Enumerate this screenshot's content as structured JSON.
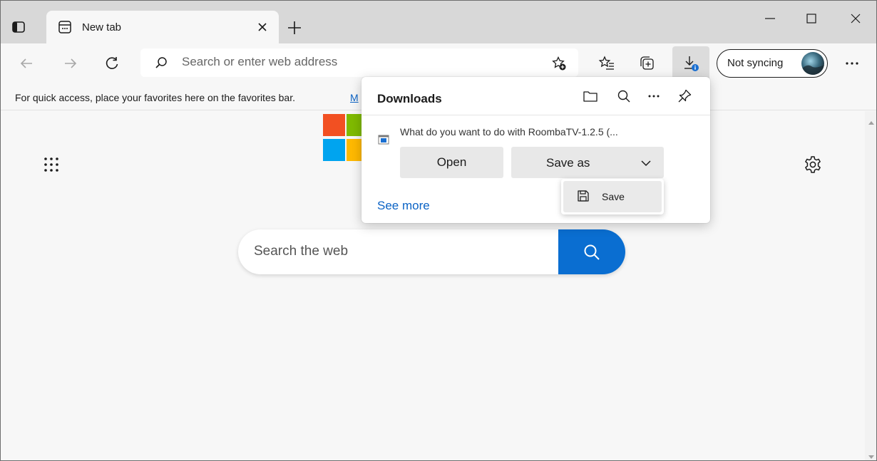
{
  "tab": {
    "title": "New tab"
  },
  "addressbar": {
    "placeholder": "Search or enter web address"
  },
  "profile": {
    "status": "Not syncing"
  },
  "favorites_bar": {
    "message": "For quick access, place your favorites here on the favorites bar.",
    "link": "M"
  },
  "new_tab_page": {
    "search_placeholder": "Search the web"
  },
  "downloads": {
    "title": "Downloads",
    "file_prompt": "What do you want to do with RoombaTV-1.2.5 (...",
    "open_label": "Open",
    "save_as_label": "Save as",
    "see_more": "See more"
  },
  "save_menu": {
    "items": [
      {
        "label": "Save"
      }
    ]
  },
  "icons": [
    "tab-actions-icon",
    "tab-favicon-icon",
    "close-icon",
    "plus-icon",
    "minimize-icon",
    "maximize-icon",
    "back-icon",
    "forward-icon",
    "refresh-icon",
    "search-icon",
    "add-favorite-icon",
    "favorites-icon",
    "collections-icon",
    "download-icon",
    "more-icon",
    "folder-icon",
    "pin-icon",
    "apps-grid-icon",
    "settings-gear-icon",
    "chevron-down-icon",
    "save-icon"
  ],
  "colors": {
    "accent": "#0a6ed1",
    "link": "#0b63c5",
    "titlebar": "#d8d8d8",
    "page_bg": "#f7f7f7"
  }
}
